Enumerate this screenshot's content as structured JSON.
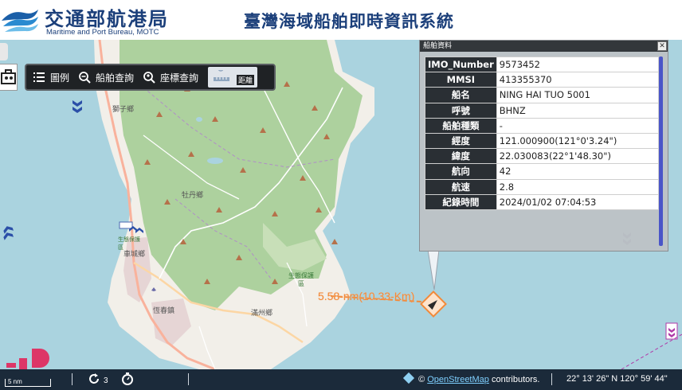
{
  "header": {
    "org_name": "交通部航港局",
    "org_subtitle": "Maritime and Port Bureau, MOTC",
    "system_title": "臺灣海域船舶即時資訊系統"
  },
  "toolbar": {
    "items": [
      {
        "label": "圖例",
        "icon": "legend-list-icon"
      },
      {
        "label": "船舶查詢",
        "icon": "zoom-search-icon"
      },
      {
        "label": "座標查詢",
        "icon": "location-search-icon"
      }
    ],
    "active_label": "距離",
    "active_icon": "ruler-icon"
  },
  "panel": {
    "title": "船舶資料",
    "close": "✕",
    "rows": [
      {
        "key": "IMO_Number",
        "value": "9573452"
      },
      {
        "key": "MMSI",
        "value": "413355370"
      },
      {
        "key": "船名",
        "value": "NING HAI TUO 5001"
      },
      {
        "key": "呼號",
        "value": "BHNZ"
      },
      {
        "key": "船舶種類",
        "value": "-"
      },
      {
        "key": "經度",
        "value": "121.000900(121°0'3.24\")"
      },
      {
        "key": "緯度",
        "value": "22.030083(22°1'48.30\")"
      },
      {
        "key": "航向",
        "value": "42"
      },
      {
        "key": "航速",
        "value": "2.8"
      },
      {
        "key": "紀錄時間",
        "value": "2024/01/02 07:04:53"
      }
    ]
  },
  "map": {
    "labels": {
      "shizi": "獅子鄉",
      "mudan": "牡丹鄉",
      "checheng": "車城鄉",
      "hengchun": "恆春鎮",
      "manzhou": "滿州鄉",
      "reserve": "生態保護區",
      "reserve2": "生態保護區"
    },
    "distance_label": "5.58-nm(10.33-Km)",
    "colors": {
      "sea": "#aad3df",
      "land": "#f2efe9",
      "forest": "#add19e",
      "road_major": "#f9b29c",
      "road_minor": "#ffffff",
      "measure_line": "#f28a3a"
    }
  },
  "bottom_bar": {
    "scale_label": "5 nm",
    "refresh_count": "3",
    "attribution_prefix": "©",
    "attribution_link": "OpenStreetMap",
    "attribution_suffix": "contributors.",
    "coordinates": "22° 13' 26\" N 120° 59' 44\""
  }
}
